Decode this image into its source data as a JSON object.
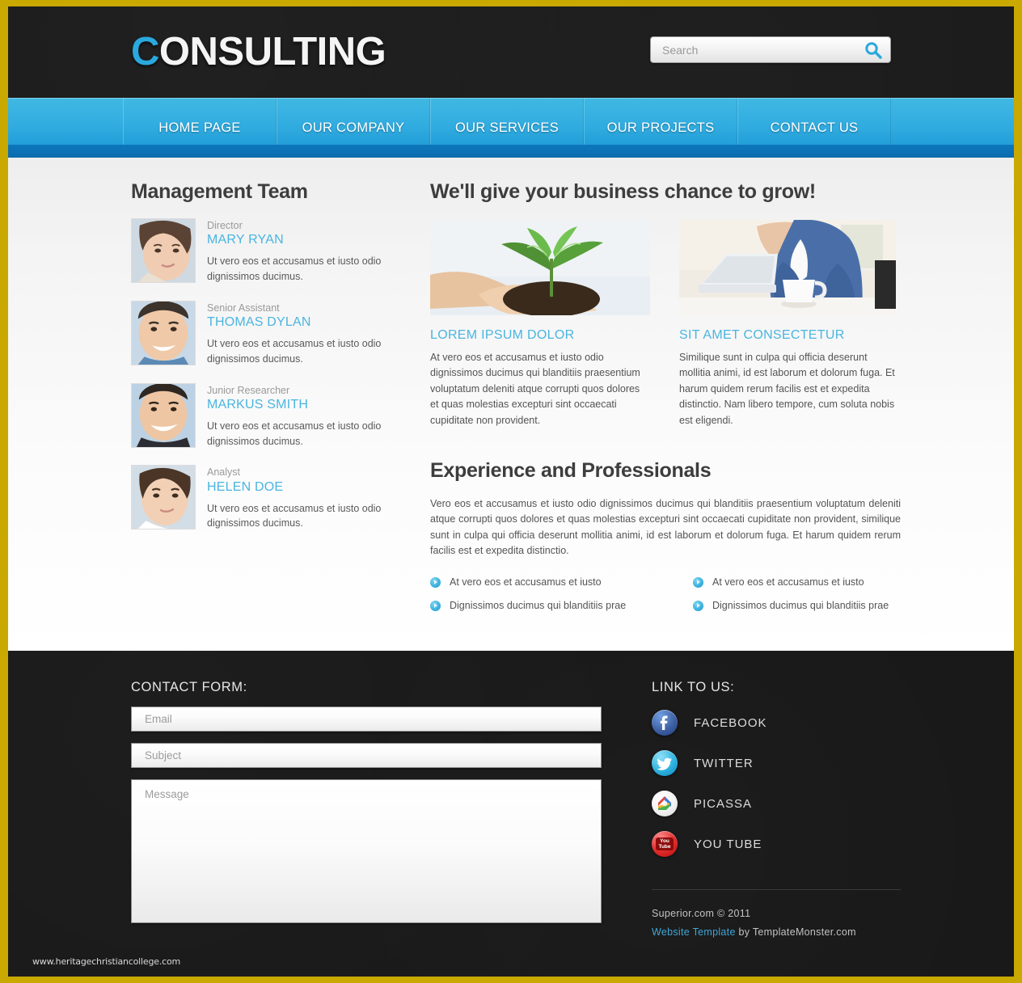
{
  "header": {
    "logo_first": "C",
    "logo_rest": "ONSULTING",
    "search": {
      "placeholder": "Search",
      "value": "",
      "icon": "search-icon"
    }
  },
  "nav": {
    "items": [
      {
        "label": "HOME PAGE"
      },
      {
        "label": "OUR COMPANY"
      },
      {
        "label": "OUR SERVICES"
      },
      {
        "label": "OUR PROJECTS"
      },
      {
        "label": "CONTACT US"
      }
    ]
  },
  "sidebar": {
    "title": "Management Team",
    "members": [
      {
        "role": "Director",
        "name": "MARY RYAN",
        "desc": "Ut vero eos et accusamus et iusto odio dignissimos ducimus."
      },
      {
        "role": "Senior Assistant",
        "name": "THOMAS DYLAN",
        "desc": "Ut vero eos et accusamus et iusto odio dignissimos ducimus."
      },
      {
        "role": "Junior Researcher",
        "name": "MARKUS SMITH",
        "desc": "Ut vero eos et accusamus et iusto odio dignissimos ducimus."
      },
      {
        "role": "Analyst",
        "name": "HELEN DOE",
        "desc": "Ut vero eos et accusamus et iusto odio dignissimos ducimus."
      }
    ]
  },
  "main": {
    "heading": "We'll give your business chance to grow!",
    "promos": [
      {
        "image_alt": "hands-holding-seedling-image",
        "title": "LOREM IPSUM DOLOR",
        "text": "At vero eos et accusamus et iusto odio dignissimos ducimus qui blanditiis praesentium voluptatum deleniti atque corrupti quos dolores et quas molestias excepturi sint occaecati cupiditate non provident."
      },
      {
        "image_alt": "man-at-laptop-with-coffee-image",
        "title": "SIT AMET CONSECTETUR",
        "text": "Similique sunt in culpa qui officia deserunt mollitia animi, id est laborum et dolorum fuga. Et harum quidem rerum facilis est et expedita distinctio. Nam libero tempore, cum soluta nobis est eligendi."
      }
    ],
    "experience": {
      "heading": "Experience and Professionals",
      "text": "Vero eos et accusamus et iusto odio dignissimos ducimus qui blanditiis praesentium voluptatum deleniti atque corrupti quos dolores et quas molestias excepturi sint occaecati cupiditate non provident, similique sunt in culpa qui officia deserunt mollitia animi, id est laborum et dolorum fuga. Et harum quidem rerum facilis est et expedita distinctio.",
      "bullets_left": [
        "At vero eos et accusamus et iusto",
        "Dignissimos ducimus qui blanditiis prae"
      ],
      "bullets_right": [
        "At vero eos et accusamus et iusto",
        "Dignissimos ducimus qui blanditiis prae"
      ]
    }
  },
  "footer": {
    "contact_form": {
      "title": "CONTACT FORM:",
      "email_placeholder": "Email",
      "email_value": "",
      "subject_placeholder": "Subject",
      "subject_value": "",
      "message_placeholder": "Message",
      "message_value": ""
    },
    "links": {
      "title": "LINK TO US:",
      "items": [
        {
          "label": "FACEBOOK",
          "icon": "facebook-icon",
          "glyph": "f",
          "color": "#3b5ca0"
        },
        {
          "label": "TWITTER",
          "icon": "twitter-icon",
          "glyph": "t",
          "color": "#2fb3e0"
        },
        {
          "label": "PICASSA",
          "icon": "picassa-icon",
          "glyph": "",
          "color": "#ffffff"
        },
        {
          "label": "YOU TUBE",
          "icon": "youtube-icon",
          "glyph": "",
          "color": "#e02b2b"
        }
      ]
    },
    "copyright": "Superior.com © 2011",
    "template_link": "Website Template",
    "template_rest": " by TemplateMonster.com"
  },
  "watermark": "www.heritagechristiancollege.com",
  "colors": {
    "accent_blue": "#4ab5e0",
    "nav_blue": "#31ace0",
    "nav_bottom_blue": "#0d77bc",
    "page_border_gold": "#c9a800",
    "dark": "#1a1a1a"
  }
}
